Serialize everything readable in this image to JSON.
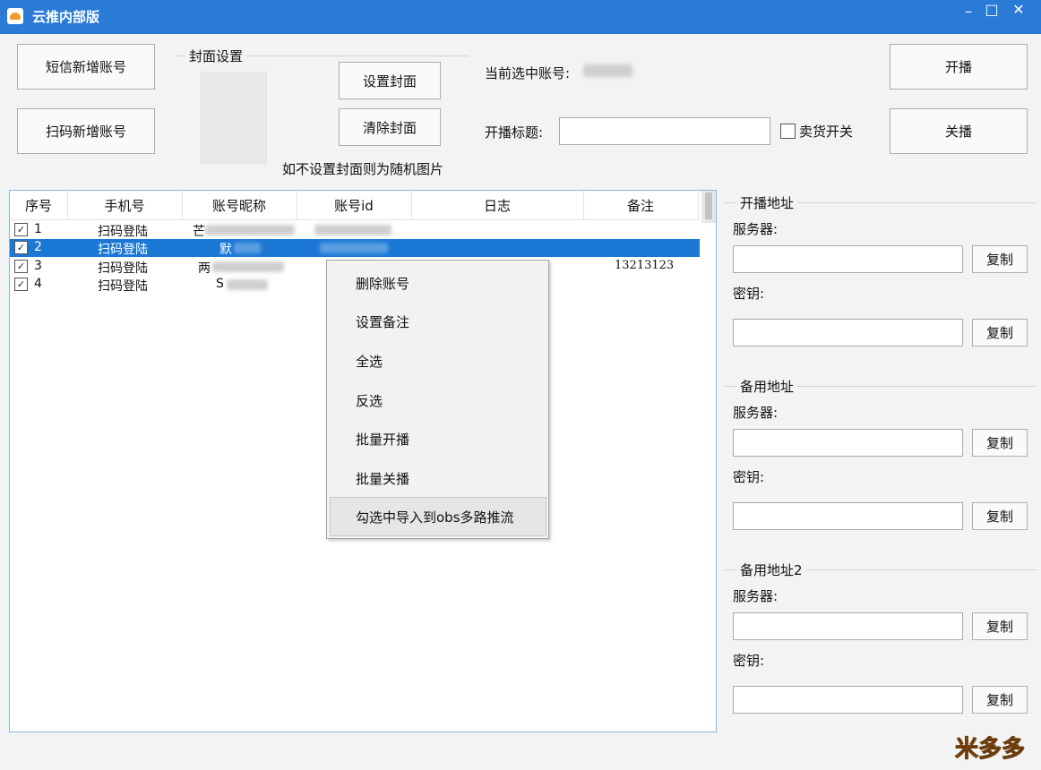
{
  "window": {
    "title": "云推内部版",
    "minimize": "–",
    "maximize": "□",
    "close": "✕"
  },
  "left_buttons": {
    "sms_add": "短信新增账号",
    "scan_add": "扫码新增账号"
  },
  "cover": {
    "group_title": "封面设置",
    "set_button": "设置封面",
    "clear_button": "清除封面",
    "hint": "如不设置封面则为随机图片"
  },
  "stream": {
    "current_account_label": "当前选中账号:",
    "title_label": "开播标题:",
    "title_value": "",
    "sell_toggle_label": "卖货开关",
    "sell_toggle_checked": false,
    "start_button": "开播",
    "stop_button": "关播"
  },
  "table": {
    "columns": [
      "序号",
      "手机号",
      "账号昵称",
      "账号id",
      "日志",
      "备注"
    ],
    "rows": [
      {
        "index": "1",
        "phone": "扫码登陆",
        "nickname": "芒",
        "account_id": "",
        "log": "",
        "note": "",
        "checked": true,
        "selected": false
      },
      {
        "index": "2",
        "phone": "扫码登陆",
        "nickname": "默",
        "account_id": "",
        "log": "",
        "note": "",
        "checked": true,
        "selected": true
      },
      {
        "index": "3",
        "phone": "扫码登陆",
        "nickname": "两",
        "account_id": "",
        "log": "",
        "note": "13213123",
        "checked": true,
        "selected": false
      },
      {
        "index": "4",
        "phone": "扫码登陆",
        "nickname": "S",
        "account_id": "",
        "log": "",
        "note": "",
        "checked": true,
        "selected": false
      }
    ]
  },
  "context_menu": {
    "items": [
      "删除账号",
      "设置备注",
      "全选",
      "反选",
      "批量开播",
      "批量关播",
      "勾选中导入到obs多路推流"
    ],
    "highlighted": "勾选中导入到obs多路推流"
  },
  "addresses": [
    {
      "group": "开播地址",
      "server_label": "服务器:",
      "key_label": "密钥:",
      "server": "",
      "key": "",
      "copy": "复制"
    },
    {
      "group": "备用地址",
      "server_label": "服务器:",
      "key_label": "密钥:",
      "server": "",
      "key": "",
      "copy": "复制"
    },
    {
      "group": "备用地址2",
      "server_label": "服务器:",
      "key_label": "密钥:",
      "server": "",
      "key": "",
      "copy": "复制"
    }
  ],
  "watermark": "米多多"
}
